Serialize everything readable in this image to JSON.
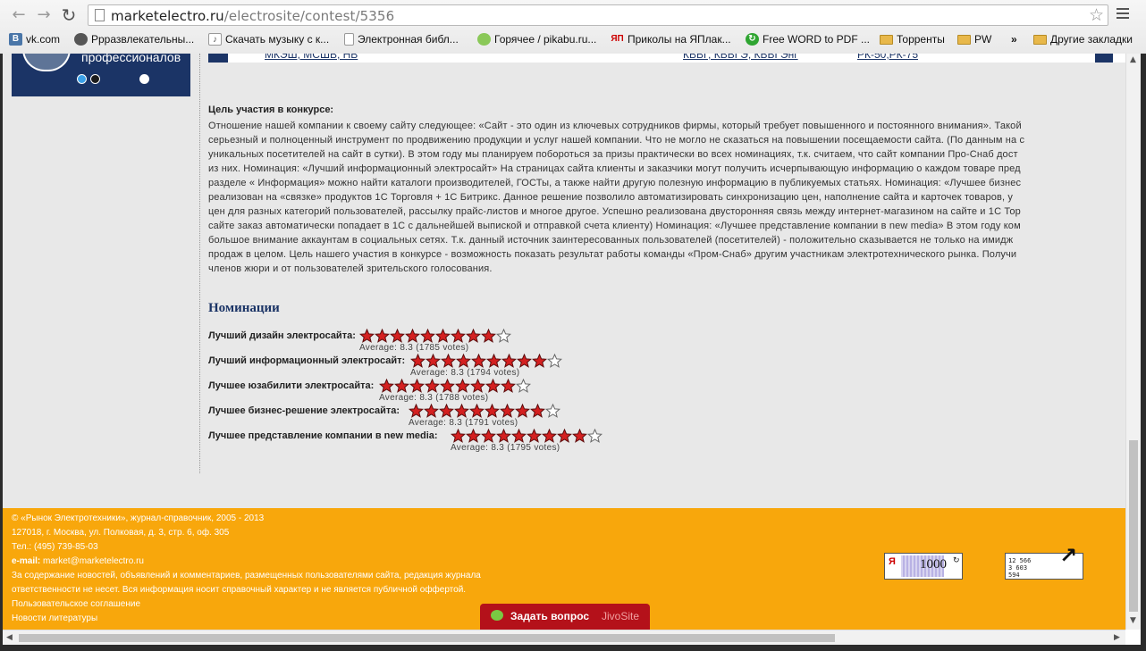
{
  "browser": {
    "url_host": "marketelectro.ru",
    "url_path": "/electrosite/contest/5356",
    "bookmarks": [
      {
        "label": "vk.com",
        "icon": "vk-icon",
        "color": "#4a76a8"
      },
      {
        "label": "Ррразвлекательны...",
        "icon": "avatar-icon",
        "color": "#555555"
      },
      {
        "label": "Скачать музыку с к...",
        "icon": "music-icon",
        "color": "#777777"
      },
      {
        "label": "Электронная библ...",
        "icon": "page-icon",
        "color": "#ffffff"
      },
      {
        "label": "Горячее / pikabu.ru...",
        "icon": "pikabu-icon",
        "color": "#8ac858"
      },
      {
        "label": "Приколы на ЯПлак...",
        "icon": "yaplakal-icon",
        "color": "#cc0000"
      },
      {
        "label": "Free WORD to PDF ...",
        "icon": "pdf-icon",
        "color": "#2fa531"
      },
      {
        "label": "Торренты",
        "icon": "folder-icon",
        "color": "#e8b84a"
      },
      {
        "label": "PW",
        "icon": "folder-icon",
        "color": "#e8b84a"
      }
    ],
    "bookmarks_more": "»",
    "other_bookmarks": "Другие закладки"
  },
  "sidebar": {
    "banner_text": "профессионалов"
  },
  "top_links": {
    "left": "МКЭШ, МСШВ, НВ",
    "mid": "КВВГ, КВВГЭ, КВВГЭнг",
    "right": "РК-50,РК-75"
  },
  "goal": {
    "title": "Цель участия в конкурсе:",
    "lines": [
      "Отношение нашей компании к своему сайту следующее: «Сайт - это один из ключевых сотрудников фирмы, который требует повышенного и постоянного внимания». Такой",
      "серьезный и полноценный инструмент по продвижению продукции и услуг нашей компании. Что не могло не сказаться на повышении посещаемости сайта. (По данным на с",
      "уникальных посетителей на сайт в сутки). В этом году мы планируем побороться за призы практически во всех номинациях, т.к. считаем, что сайт компании Про-Снаб дост",
      "из них. Номинация: «Лучший информационный электросайт» На страницах сайта клиенты и заказчики могут получить исчерпывающую информацию о каждом товаре пред",
      "разделе « Информация» можно найти каталоги производителей, ГОСТы, а также найти другую полезную информацию в публикуемых статьях. Номинация: «Лучшее бизнес",
      "реализован на «связке» продуктов 1С Торговля + 1С Битрикс. Данное решение позволило автоматизировать синхронизацию цен, наполнение сайта и карточек товаров, у",
      "цен для разных категорий пользователей, рассылку прайс-листов и многое другое. Успешно реализована двусторонняя связь между интернет-магазином на сайте и 1С Тор",
      "сайте заказ автоматически попадает в 1С с дальнейшей выпиской и отправкой счета клиенту) Номинация: «Лучшее представление компании в new media» В этом году ком",
      "большое внимание аккаунтам в социальных сетях. Т.к. данный источник заинтересованных пользователей (посетителей) - положительно сказывается не только на имидж",
      "продаж в целом. Цель нашего участия в конкурсе - возможность показать результат работы команды «Пром-Снаб» другим участникам электротехнического рынка. Получи",
      "членов жюри и от пользователей зрительского голосования."
    ]
  },
  "nominations": {
    "title": "Номинации",
    "items": [
      {
        "label": "Лучший дизайн электросайта:",
        "rating": 9,
        "max": 10,
        "avg_text": "Average: 8.3 (1785 votes)"
      },
      {
        "label": "Лучший информационный электросайт:",
        "rating": 9,
        "max": 10,
        "avg_text": "Average: 8.3 (1794 votes)"
      },
      {
        "label": "Лучшее юзабилити электросайта:",
        "rating": 9,
        "max": 10,
        "avg_text": "Average: 8.3 (1788 votes)"
      },
      {
        "label": "Лучшее бизнес-решение электросайта:",
        "rating": 9,
        "max": 10,
        "avg_text": "Average: 8.3 (1791 votes)"
      },
      {
        "label": "Лучшее представление компании в new media:",
        "rating": 9,
        "max": 10,
        "avg_text": "Average: 8.3 (1795 votes)"
      }
    ]
  },
  "footer": {
    "copyright": "© «Рынок Электротехники», журнал-справочник, 2005 - 2013",
    "address": "127018, г. Москва, ул. Полковая, д. 3, стр. 6, оф. 305",
    "phone": "Тел.: (495) 739-85-03",
    "email_label": "e-mail:",
    "email": "market@marketelectro.ru",
    "disclaimer1": "За содержание новостей, объявлений и комментариев, размещенных пользователями сайта, редакция журнала",
    "disclaimer2": "ответственности не несет. Вся информация носит справочный характер и не является публичной оффертой.",
    "link_agreement": "Пользовательское соглашение",
    "link_news": "Новости литературы",
    "counter_yandex": "1000",
    "counter2_lines": [
      "12 566",
      "3 603",
      "594"
    ],
    "jivo_label": "Задать вопрос",
    "jivo_brand": "JivoSite"
  },
  "colors": {
    "footer_bg": "#f8a70c",
    "star_fill": "#d42020",
    "heading": "#1b3466",
    "jivo_bg": "#b4111a"
  }
}
